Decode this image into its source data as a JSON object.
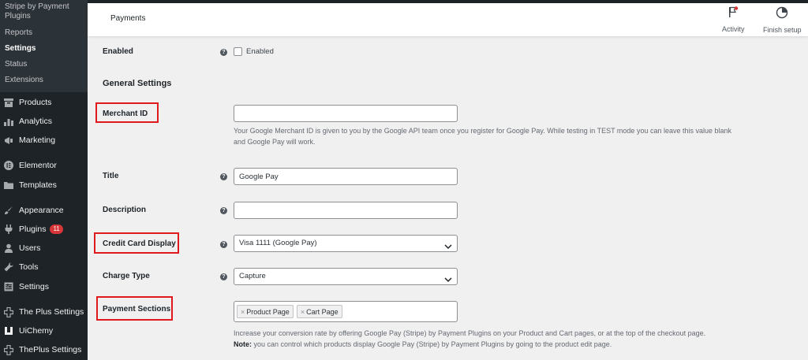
{
  "sidebar": {
    "sub_items": [
      {
        "label": "Stripe by Payment",
        "current": false
      },
      {
        "label": "Plugins",
        "current": false
      },
      {
        "label": "Reports",
        "current": false
      },
      {
        "label": "Settings",
        "current": true
      },
      {
        "label": "Status",
        "current": false
      },
      {
        "label": "Extensions",
        "current": false
      }
    ],
    "menu": [
      {
        "label": "Products",
        "icon": "archive-icon"
      },
      {
        "label": "Analytics",
        "icon": "bar-chart-icon"
      },
      {
        "label": "Marketing",
        "icon": "megaphone-icon"
      },
      {
        "label": "Elementor",
        "icon": "elementor-icon"
      },
      {
        "label": "Templates",
        "icon": "folder-icon"
      },
      {
        "label": "Appearance",
        "icon": "brush-icon"
      },
      {
        "label": "Plugins",
        "icon": "plug-icon",
        "badge": "11"
      },
      {
        "label": "Users",
        "icon": "user-icon"
      },
      {
        "label": "Tools",
        "icon": "wrench-icon"
      },
      {
        "label": "Settings",
        "icon": "settings-icon"
      },
      {
        "label": "The Plus Settings",
        "icon": "plus-settings-icon"
      },
      {
        "label": "UiChemy",
        "icon": "uichemy-icon"
      },
      {
        "label": "ThePlus Settings",
        "icon": "plus-settings-icon"
      }
    ]
  },
  "header": {
    "title": "Payments",
    "activity_label": "Activity",
    "finish_setup_label": "Finish setup"
  },
  "form": {
    "enabled": {
      "label": "Enabled",
      "checkbox_label": "Enabled",
      "checked": false
    },
    "general_settings_title": "General Settings",
    "merchant_id": {
      "label": "Merchant ID",
      "value": "",
      "desc_line1": "Your Google Merchant ID is given to you by the Google API team once you register for Google Pay. While testing in TEST mode you can leave this value blank",
      "desc_line2": "and Google Pay will work."
    },
    "title": {
      "label": "Title",
      "value": "Google Pay"
    },
    "description": {
      "label": "Description",
      "value": ""
    },
    "credit_card_display": {
      "label": "Credit Card Display",
      "selected": "Visa 1111 (Google Pay)"
    },
    "charge_type": {
      "label": "Charge Type",
      "selected": "Capture"
    },
    "payment_sections": {
      "label": "Payment Sections",
      "chips": [
        "Product Page",
        "Cart Page"
      ],
      "desc_line1": "Increase your conversion rate by offering Google Pay (Stripe) by Payment Plugins on your Product and Cart pages, or at the top of the checkout page.",
      "note_label": "Note:",
      "note_text": " you can control which products display Google Pay (Stripe) by Payment Plugins by going to the product edit page."
    },
    "help_symbol": "?"
  },
  "colors": {
    "sidebar_bg": "#1d2327",
    "highlight": "#e0191d",
    "badge": "#d63638"
  }
}
